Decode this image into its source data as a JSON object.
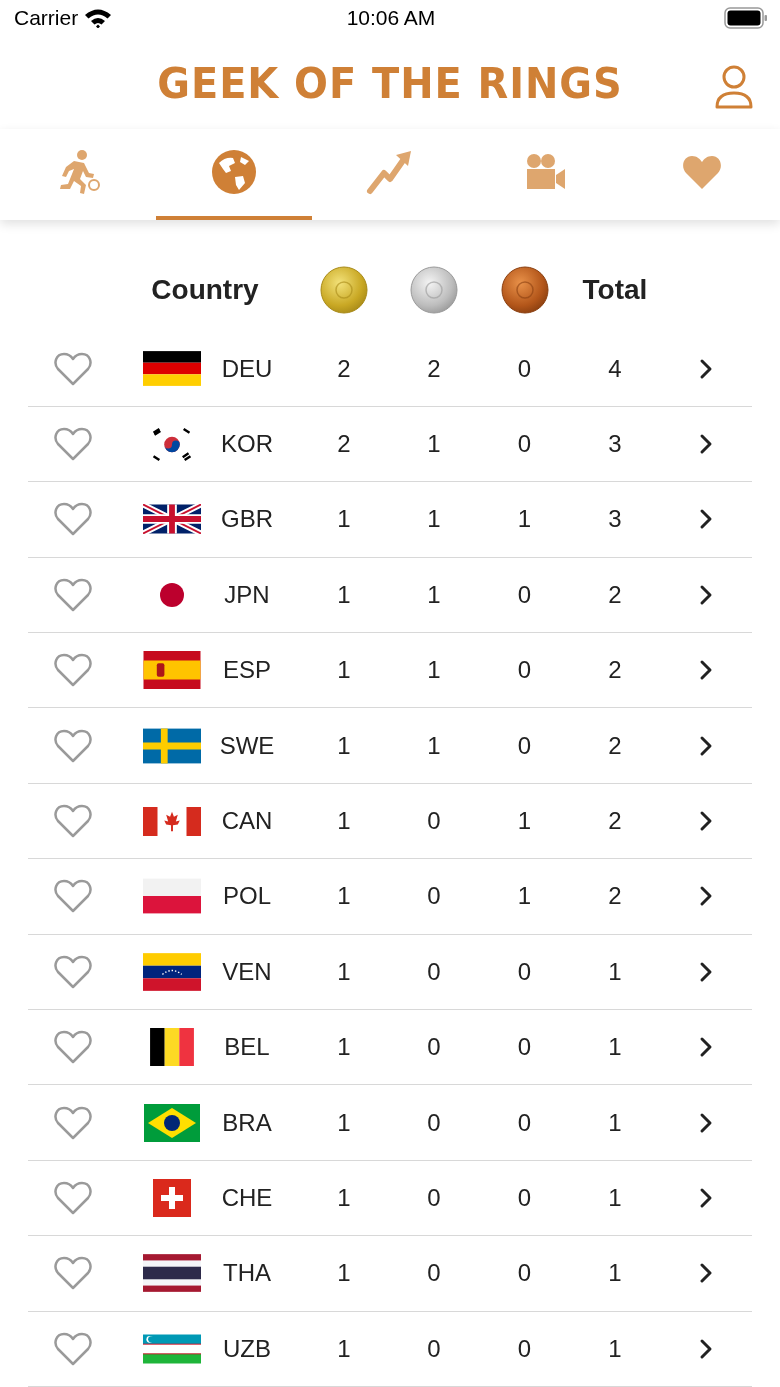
{
  "status_bar": {
    "carrier": "Carrier",
    "time": "10:06 AM"
  },
  "header": {
    "title": "GEEK OF THE RINGS"
  },
  "tabs": [
    {
      "kind": "sport",
      "selected": false
    },
    {
      "kind": "globe",
      "selected": true
    },
    {
      "kind": "trend",
      "selected": false
    },
    {
      "kind": "video",
      "selected": false
    },
    {
      "kind": "heart",
      "selected": false
    }
  ],
  "table": {
    "columns": [
      {
        "kind": "text",
        "label": "Country"
      },
      {
        "kind": "gold"
      },
      {
        "kind": "silver"
      },
      {
        "kind": "bronze"
      },
      {
        "kind": "text",
        "label": "Total"
      }
    ],
    "rows": [
      {
        "favorite": false,
        "kind": "deu",
        "country": "DEU",
        "gold": "2",
        "silver": "2",
        "bronze": "0",
        "total": "4"
      },
      {
        "favorite": false,
        "kind": "kor",
        "country": "KOR",
        "gold": "2",
        "silver": "1",
        "bronze": "0",
        "total": "3"
      },
      {
        "favorite": false,
        "kind": "gbr",
        "country": "GBR",
        "gold": "1",
        "silver": "1",
        "bronze": "1",
        "total": "3"
      },
      {
        "favorite": false,
        "kind": "jpn",
        "country": "JPN",
        "gold": "1",
        "silver": "1",
        "bronze": "0",
        "total": "2"
      },
      {
        "favorite": false,
        "kind": "esp",
        "country": "ESP",
        "gold": "1",
        "silver": "1",
        "bronze": "0",
        "total": "2"
      },
      {
        "favorite": false,
        "kind": "swe",
        "country": "SWE",
        "gold": "1",
        "silver": "1",
        "bronze": "0",
        "total": "2"
      },
      {
        "favorite": false,
        "kind": "can",
        "country": "CAN",
        "gold": "1",
        "silver": "0",
        "bronze": "1",
        "total": "2"
      },
      {
        "favorite": false,
        "kind": "pol",
        "country": "POL",
        "gold": "1",
        "silver": "0",
        "bronze": "1",
        "total": "2"
      },
      {
        "favorite": false,
        "kind": "ven",
        "country": "VEN",
        "gold": "1",
        "silver": "0",
        "bronze": "0",
        "total": "1"
      },
      {
        "favorite": false,
        "kind": "bel",
        "country": "BEL",
        "gold": "1",
        "silver": "0",
        "bronze": "0",
        "total": "1"
      },
      {
        "favorite": false,
        "kind": "bra",
        "country": "BRA",
        "gold": "1",
        "silver": "0",
        "bronze": "0",
        "total": "1"
      },
      {
        "favorite": false,
        "kind": "che",
        "country": "CHE",
        "gold": "1",
        "silver": "0",
        "bronze": "0",
        "total": "1"
      },
      {
        "favorite": false,
        "kind": "tha",
        "country": "THA",
        "gold": "1",
        "silver": "0",
        "bronze": "0",
        "total": "1"
      },
      {
        "favorite": false,
        "kind": "uzb",
        "country": "UZB",
        "gold": "1",
        "silver": "0",
        "bronze": "0",
        "total": "1"
      }
    ]
  }
}
